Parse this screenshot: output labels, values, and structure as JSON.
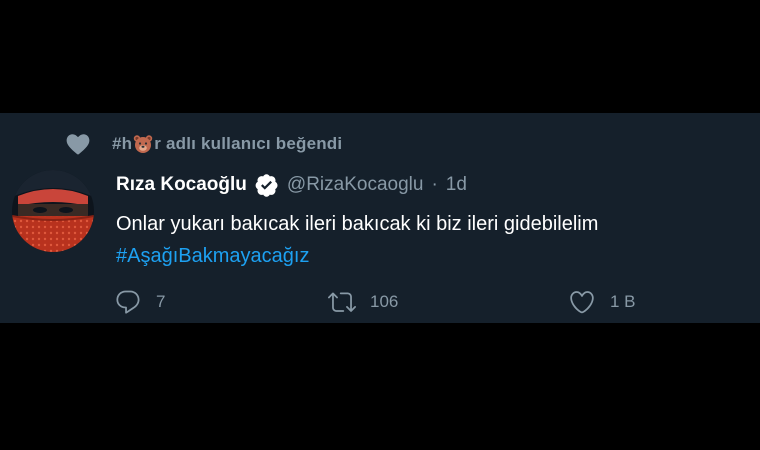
{
  "liked_by": {
    "prefix": "#h",
    "suffix": "r adlı kullanıcı beğendi",
    "emoji_icon": "bear-face-icon"
  },
  "tweet": {
    "display_name": "Rıza Kocaoğlu",
    "verified_icon": "verified-badge-icon",
    "handle": "@RizaKocaoglu",
    "separator": "·",
    "time": "1d",
    "text": "Onlar yukarı bakıcak ileri bakıcak ki biz ileri gidebilelim",
    "hashtag": "#AşağıBakmayacağız"
  },
  "actions": {
    "reply": {
      "icon": "reply-icon",
      "count": "7"
    },
    "retweet": {
      "icon": "retweet-icon",
      "count": "106"
    },
    "like": {
      "icon": "heart-icon",
      "count": "1 B"
    }
  },
  "colors": {
    "background": "#000000",
    "card": "#15202b",
    "muted": "#8899a6",
    "link": "#1da1f2",
    "text": "#ffffff"
  }
}
